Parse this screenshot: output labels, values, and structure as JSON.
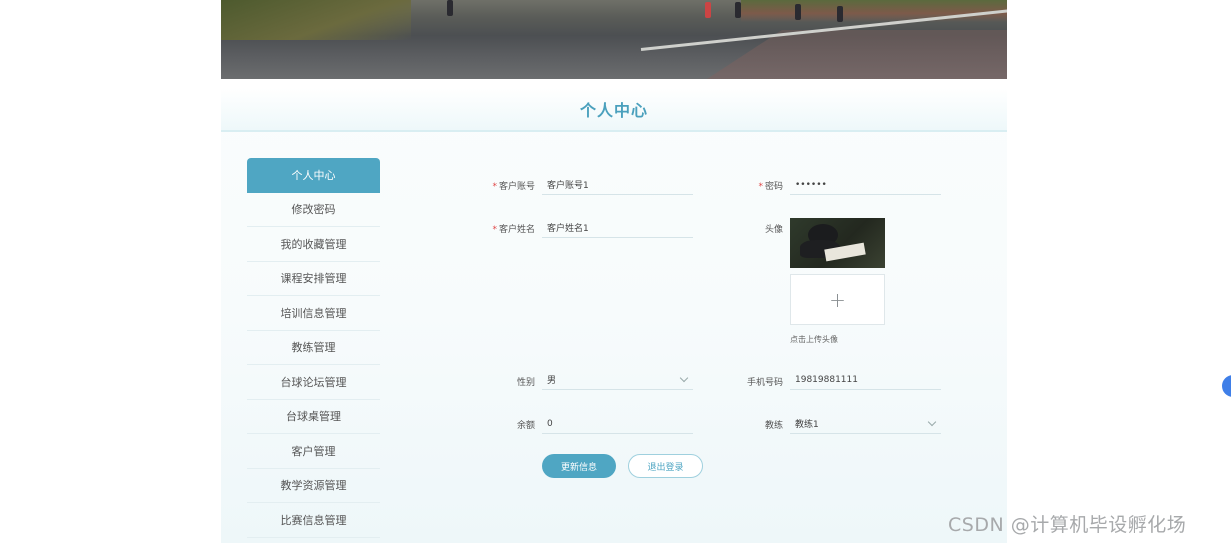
{
  "page": {
    "title": "个人中心"
  },
  "menu": {
    "items": [
      {
        "label": "个人中心"
      },
      {
        "label": "修改密码"
      },
      {
        "label": "我的收藏管理"
      },
      {
        "label": "课程安排管理"
      },
      {
        "label": "培训信息管理"
      },
      {
        "label": "教练管理"
      },
      {
        "label": "台球论坛管理"
      },
      {
        "label": "台球桌管理"
      },
      {
        "label": "客户管理"
      },
      {
        "label": "教学资源管理"
      },
      {
        "label": "比赛信息管理"
      }
    ]
  },
  "form": {
    "account": {
      "label": "客户账号",
      "value": "客户账号1",
      "required": true
    },
    "password": {
      "label": "密码",
      "value": "••••••",
      "required": true
    },
    "name": {
      "label": "客户姓名",
      "value": "客户姓名1",
      "required": true
    },
    "avatar": {
      "label": "头像",
      "upload_icon": "plus-icon",
      "upload_hint": "点击上传头像"
    },
    "gender": {
      "label": "性别",
      "value": "男"
    },
    "phone": {
      "label": "手机号码",
      "value": "19819881111"
    },
    "balance": {
      "label": "余额",
      "value": "0"
    },
    "coach": {
      "label": "教练",
      "value": "教练1"
    }
  },
  "buttons": {
    "update": "更新信息",
    "logout": "退出登录"
  },
  "watermark": "CSDN @计算机毕设孵化场",
  "colors": {
    "accent": "#4fa6c3",
    "title": "#4aa0bd",
    "required": "#e04646"
  }
}
